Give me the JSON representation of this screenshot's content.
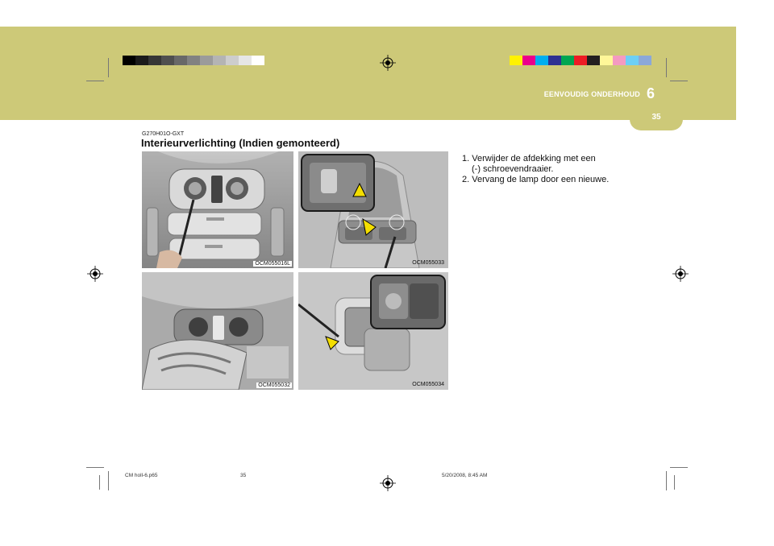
{
  "header": {
    "chapter_label": "EENVOUDIG ONDERHOUD",
    "chapter_number": "6",
    "page_number": "35",
    "band_color": "#cdc978"
  },
  "section": {
    "code": "G270H01O-GXT",
    "title": "Interieurverlichting (Indien gemonteerd)"
  },
  "figures": [
    {
      "ref": "OCM055016L"
    },
    {
      "ref": "OCM055033"
    },
    {
      "ref": "OCM055032"
    },
    {
      "ref": "OCM055034"
    }
  ],
  "instructions": [
    {
      "number": "1.",
      "line1": "Verwijder de afdekking met een",
      "line2": "(-) schroevendraaier."
    },
    {
      "number": "2.",
      "line1": "Vervang de lamp door een nieuwe.",
      "line2": ""
    }
  ],
  "footer": {
    "file": "CM holl-6.p65",
    "page": "35",
    "timestamp": "5/20/2008, 8:45 AM"
  },
  "color_strips": {
    "gray": [
      "#000000",
      "#1b1b1b",
      "#363636",
      "#4f4f4f",
      "#686868",
      "#818181",
      "#9b9b9b",
      "#b4b4b4",
      "#cdcdcd",
      "#e6e6e6",
      "#ffffff"
    ],
    "color": [
      "#fff200",
      "#ec008c",
      "#00aeef",
      "#2e3192",
      "#00a651",
      "#ed1c24",
      "#231f20",
      "#fff799",
      "#f49ac1",
      "#6dcff6",
      "#8ba8d8"
    ]
  }
}
